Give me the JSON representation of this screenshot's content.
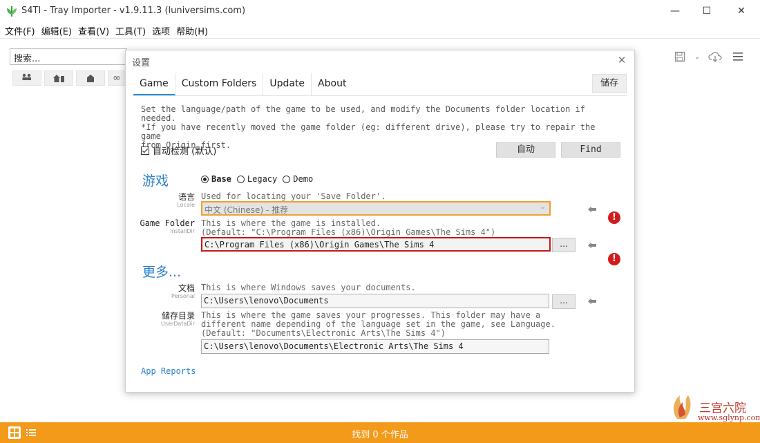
{
  "window": {
    "title": "S4TI - Tray Importer - v1.9.11.3  (luniversims.com)",
    "brand_color": "#f39a1b"
  },
  "menu": [
    "文件(F)",
    "编辑(E)",
    "查看(V)",
    "工具(T)",
    "选项",
    "帮助(H)"
  ],
  "search": {
    "placeholder": "搜索..."
  },
  "statusbar": {
    "found_text": "找到   0   个作品"
  },
  "dialog": {
    "title": "设置",
    "tabs": [
      "Game",
      "Custom Folders",
      "Update",
      "About"
    ],
    "active_tab": "Game",
    "save_label": "储存",
    "description": "Set the language/path of the game to be used, and modify the Documents folder location if needed.\n*If you have recently moved the game folder (eg: different drive), please try to repair the game\nfrom Origin first.",
    "auto_detect": {
      "label": "自动检测 (默认)",
      "checked": true
    },
    "auto_button": "自动",
    "find_button": "Find",
    "game_section": {
      "heading": "游戏",
      "editions": [
        "Base",
        "Legacy",
        "Demo"
      ],
      "selected_edition": "Base",
      "locale": {
        "label": "语言",
        "sublabel": "Locale",
        "hint": "Used for locating your 'Save Folder'.",
        "value": "中文             (Chinese)  -  推荐"
      },
      "install_dir": {
        "label": "Game Folder",
        "sublabel": "InstallDir",
        "hint": "This is where the game is installed.\n(Default: \"C:\\Program Files (x86)\\Origin Games\\The Sims 4\")",
        "value": "C:\\Program Files (x86)\\Origin Games\\The Sims 4",
        "browse_label": "..."
      }
    },
    "more_section": {
      "heading": "更多...",
      "personal": {
        "label": "文档",
        "sublabel": "Personal",
        "hint": "This is where Windows saves your documents.",
        "value": "C:\\Users\\lenovo\\Documents",
        "browse_label": "..."
      },
      "user_data_dir": {
        "label": "储存目录",
        "sublabel": "UserDataDir",
        "hint": "This is where the game saves your progresses. This folder may have a\ndifferent name depending of the language set in the game, see Language.\n(Default: \"Documents\\Electronic Arts\\The Sims 4\")",
        "value": "C:\\Users\\lenovo\\Documents\\Electronic Arts\\The Sims 4"
      }
    },
    "app_reports": "App Reports"
  },
  "watermark": {
    "text": "www.sglynp.com"
  }
}
